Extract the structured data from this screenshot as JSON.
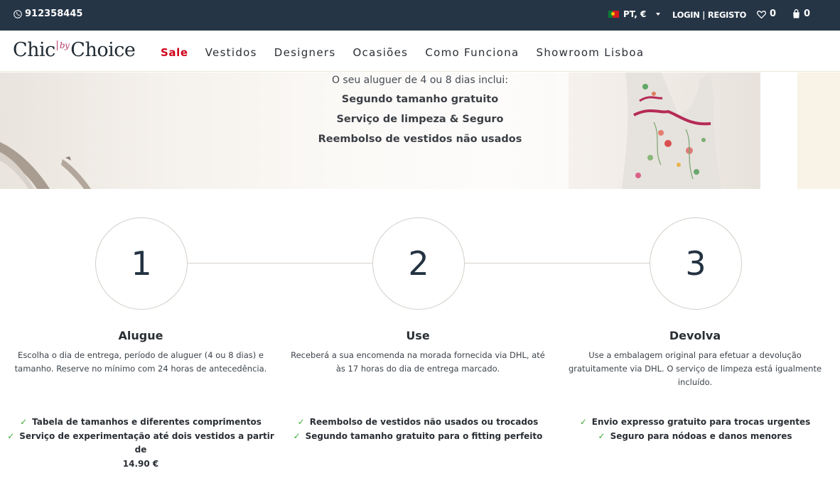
{
  "topbar": {
    "phone": "912358445",
    "locale": "PT, €",
    "login": "LOGIN | REGISTO",
    "wishlist_count": "0",
    "cart_count": "0"
  },
  "logo": {
    "left": "Chic",
    "by": "by",
    "right": "Choice"
  },
  "nav": {
    "items": [
      {
        "label": "Sale"
      },
      {
        "label": "Vestidos"
      },
      {
        "label": "Designers"
      },
      {
        "label": "Ocasiões"
      },
      {
        "label": "Como Funciona"
      },
      {
        "label": "Showroom Lisboa"
      }
    ]
  },
  "hero": {
    "intro": "O seu aluguer de 4 ou 8 dias inclui:",
    "lines": [
      "Segundo tamanho gratuito",
      "Serviço de limpeza & Seguro",
      "Reembolso de vestidos não usados"
    ]
  },
  "steps": [
    {
      "number": "1",
      "title": "Alugue",
      "desc": [
        "Escolha o dia de entrega, período de aluguer (4 ou 8 dias) e",
        "tamanho. Reserve no mínimo com 24 horas de antecedência."
      ],
      "checks": [
        "Tabela de tamanhos e diferentes comprimentos",
        "Serviço de experimentação até dois vestidos a partir de"
      ],
      "checks_extra": "14.90 €"
    },
    {
      "number": "2",
      "title": "Use",
      "desc": [
        "Receberá a sua encomenda na morada fornecida via DHL, até",
        "às 17 horas do dia de entrega marcado."
      ],
      "checks": [
        "Reembolso de vestidos não usados ou trocados",
        "Segundo tamanho gratuito para o fitting perfeito"
      ]
    },
    {
      "number": "3",
      "title": "Devolva",
      "desc": [
        "Use a embalagem original para efetuar a devolução",
        "gratuitamente via DHL. O serviço de limpeza está igualmente",
        "incluído."
      ],
      "checks": [
        "Envio expresso gratuito para trocas urgentes",
        "Seguro para nódoas e danos menores"
      ]
    }
  ],
  "colors": {
    "topbar_bg": "#253546",
    "sale_red": "#d0021b",
    "check_green": "#3fae3a",
    "logo_accent": "#b8396b"
  }
}
